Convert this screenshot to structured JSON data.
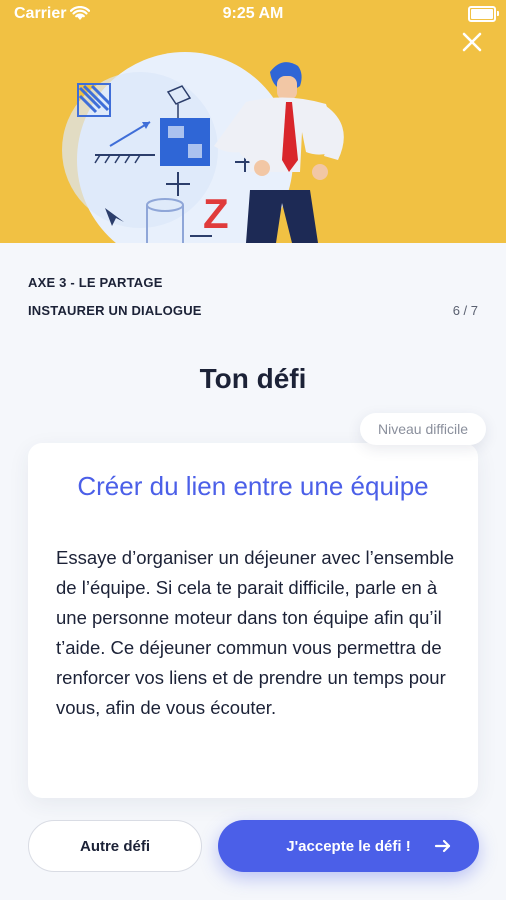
{
  "status_bar": {
    "carrier": "Carrier",
    "time": "9:25 AM",
    "icons": [
      "wifi-icon",
      "battery-icon"
    ]
  },
  "header": {
    "close_icon": "close-icon",
    "illustration": "business-man-illustration"
  },
  "lesson": {
    "axis": "AXE 3 - LE PARTAGE",
    "title": "INSTAURER UN DIALOGUE",
    "progress": "6 / 7"
  },
  "challenge": {
    "heading": "Ton défi",
    "level": "Niveau difficile",
    "title": "Créer du lien entre une équipe",
    "description": "Essaye d’organiser un déjeuner avec l’ensemble de l’équipe. Si cela te parait difficile, parle en à une personne moteur dans ton équipe afin qu’il t’aide. Ce déjeuner commun vous permettra de renforcer vos liens et de prendre un temps pour vous, afin de vous écouter."
  },
  "actions": {
    "other_label": "Autre défi",
    "accept_label": "J'accepte le défi !",
    "accept_icon": "arrow-right-icon"
  },
  "colors": {
    "header_bg": "#f1c143",
    "accent": "#4b5fe8",
    "text": "#1c2237",
    "muted": "#8a8f9c",
    "page_bg": "#f5f7fb"
  }
}
